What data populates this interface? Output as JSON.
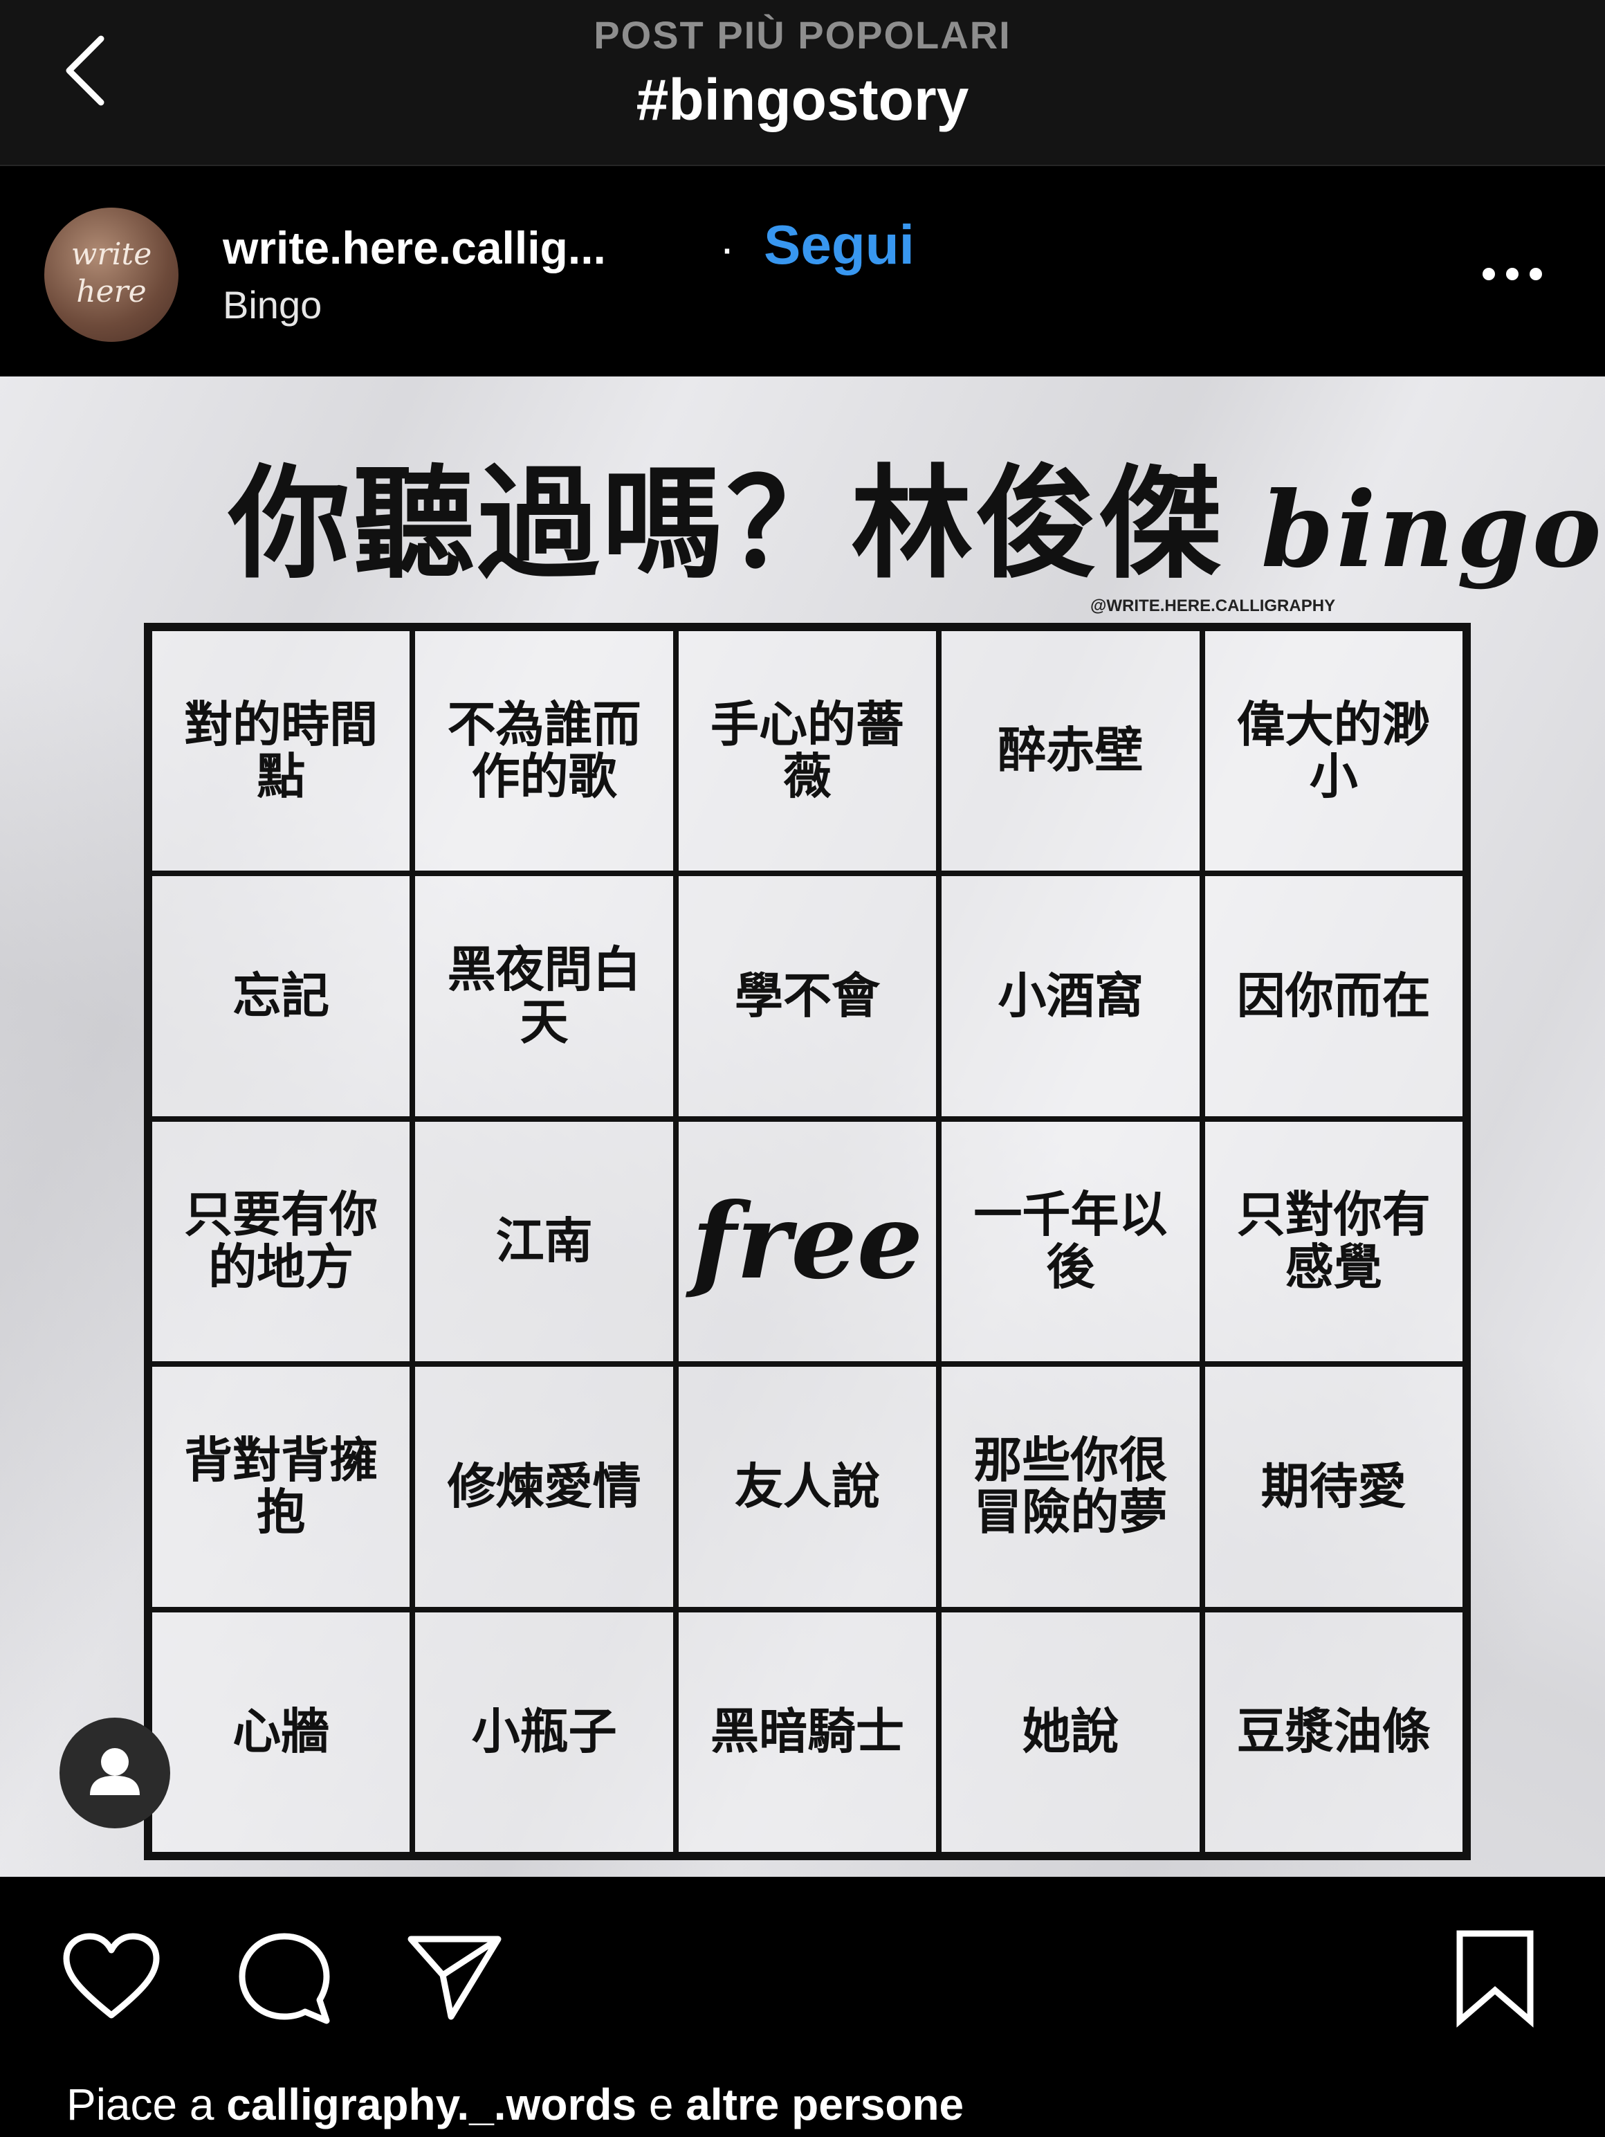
{
  "nav": {
    "subtitle": "POST PIÙ POPOLARI",
    "title": "#bingostory",
    "back_icon": "chevron-left-icon"
  },
  "post": {
    "avatar_text_1": "write",
    "avatar_text_2": "here",
    "username": "write.here.callig...",
    "separator": "·",
    "follow_label": "Segui",
    "location": "Bingo",
    "more_icon": "more-horizontal-icon"
  },
  "image": {
    "title": "你聽過嗎？林俊傑",
    "title_latin": "bingo",
    "watermark": "@WRITE.HERE.CALLIGRAPHY",
    "cells": [
      "對的時間點",
      "不為誰而作的歌",
      "手心的薔薇",
      "醉赤壁",
      "偉大的渺小",
      "忘記",
      "黑夜問白天",
      "學不會",
      "小酒窩",
      "因你而在",
      "只要有你的地方",
      "江南",
      "free",
      "一千年以後",
      "只對你有感覺",
      "背對背擁抱",
      "修煉愛情",
      "友人說",
      "那些你很冒險的夢",
      "期待愛",
      "心牆",
      "小瓶子",
      "黑暗騎士",
      "她說",
      "豆漿油條"
    ],
    "tag_icon": "user-tag-icon"
  },
  "actions": {
    "like_icon": "heart-icon",
    "comment_icon": "comment-icon",
    "share_icon": "send-icon",
    "save_icon": "bookmark-icon",
    "likes_prefix": "Piace a ",
    "likes_user": "calligraphy._.words",
    "likes_mid": " e ",
    "likes_suffix": "altre persone"
  },
  "colors": {
    "accent": "#3897f0",
    "background": "#000000",
    "topbar": "#141414"
  }
}
